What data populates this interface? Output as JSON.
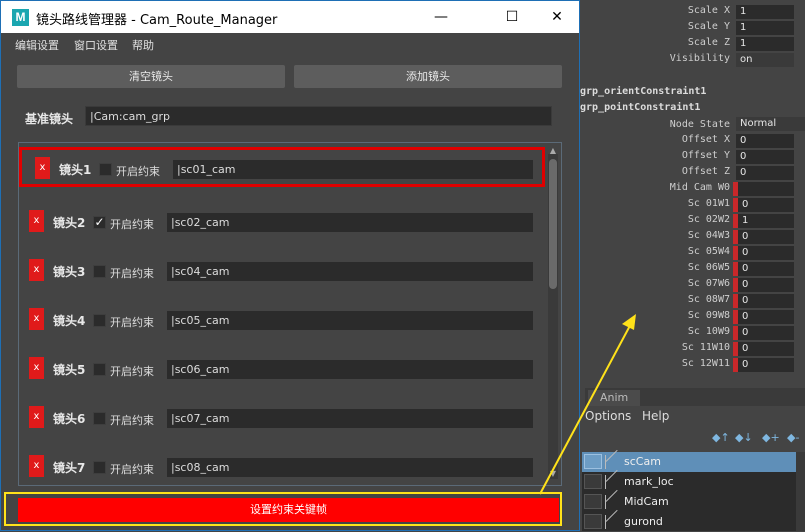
{
  "window": {
    "title": "镜头路线管理器 - Cam_Route_Manager",
    "app_icon": "M",
    "minimize": "—",
    "maximize": "☐",
    "close": "✕"
  },
  "menu": [
    "编辑设置",
    "窗口设置",
    "帮助"
  ],
  "buttons": {
    "clear": "清空镜头",
    "add": "添加镜头",
    "set_key": "设置约束关键帧"
  },
  "base": {
    "label": "基准镜头",
    "value": "|Cam:cam_grp"
  },
  "cameras": [
    {
      "del": "x",
      "label": "镜头1",
      "checked": false,
      "constraint": "开启约束",
      "value": "|sc01_cam"
    },
    {
      "del": "x",
      "label": "镜头2",
      "checked": true,
      "constraint": "开启约束",
      "value": "|sc02_cam"
    },
    {
      "del": "x",
      "label": "镜头3",
      "checked": false,
      "constraint": "开启约束",
      "value": "|sc04_cam"
    },
    {
      "del": "x",
      "label": "镜头4",
      "checked": false,
      "constraint": "开启约束",
      "value": "|sc05_cam"
    },
    {
      "del": "x",
      "label": "镜头5",
      "checked": false,
      "constraint": "开启约束",
      "value": "|sc06_cam"
    },
    {
      "del": "x",
      "label": "镜头6",
      "checked": false,
      "constraint": "开启约束",
      "value": "|sc07_cam"
    },
    {
      "del": "x",
      "label": "镜头7",
      "checked": false,
      "constraint": "开启约束",
      "value": "|sc08_cam"
    }
  ],
  "attr_editor": {
    "scale": [
      {
        "label": "Scale X",
        "value": "1"
      },
      {
        "label": "Scale Y",
        "value": "1"
      },
      {
        "label": "Scale Z",
        "value": "1"
      }
    ],
    "visibility": {
      "label": "Visibility",
      "value": "on"
    },
    "sections": [
      "grp_orientConstraint1",
      "grp_pointConstraint1"
    ],
    "node_state": {
      "label": "Node State",
      "value": "Normal"
    },
    "offsets": [
      {
        "label": "Offset X",
        "value": "0"
      },
      {
        "label": "Offset Y",
        "value": "0"
      },
      {
        "label": "Offset Z",
        "value": "0"
      }
    ],
    "weights": [
      {
        "label": "Mid Cam W0",
        "value": ""
      },
      {
        "label": "Sc 01W1",
        "value": "0"
      },
      {
        "label": "Sc 02W2",
        "value": "1"
      },
      {
        "label": "Sc 04W3",
        "value": "0"
      },
      {
        "label": "Sc 05W4",
        "value": "0"
      },
      {
        "label": "Sc 06W5",
        "value": "0"
      },
      {
        "label": "Sc 07W6",
        "value": "0"
      },
      {
        "label": "Sc 08W7",
        "value": "0"
      },
      {
        "label": "Sc 09W8",
        "value": "0"
      },
      {
        "label": "Sc 10W9",
        "value": "0"
      },
      {
        "label": "Sc 11W10",
        "value": "0"
      },
      {
        "label": "Sc 12W11",
        "value": "0"
      }
    ]
  },
  "outliner": {
    "tab": "Anim",
    "menu": [
      "Options",
      "Help"
    ],
    "items": [
      {
        "label": "scCam",
        "selected": true
      },
      {
        "label": "mark_loc",
        "selected": false
      },
      {
        "label": "MidCam",
        "selected": false
      },
      {
        "label": "gurond",
        "selected": false
      }
    ]
  },
  "colors": {
    "highlight_red": "#e00000",
    "annotation_yellow": "#ffe21a",
    "key_button": "#ff0000",
    "selection_blue": "#5f8fb8"
  }
}
